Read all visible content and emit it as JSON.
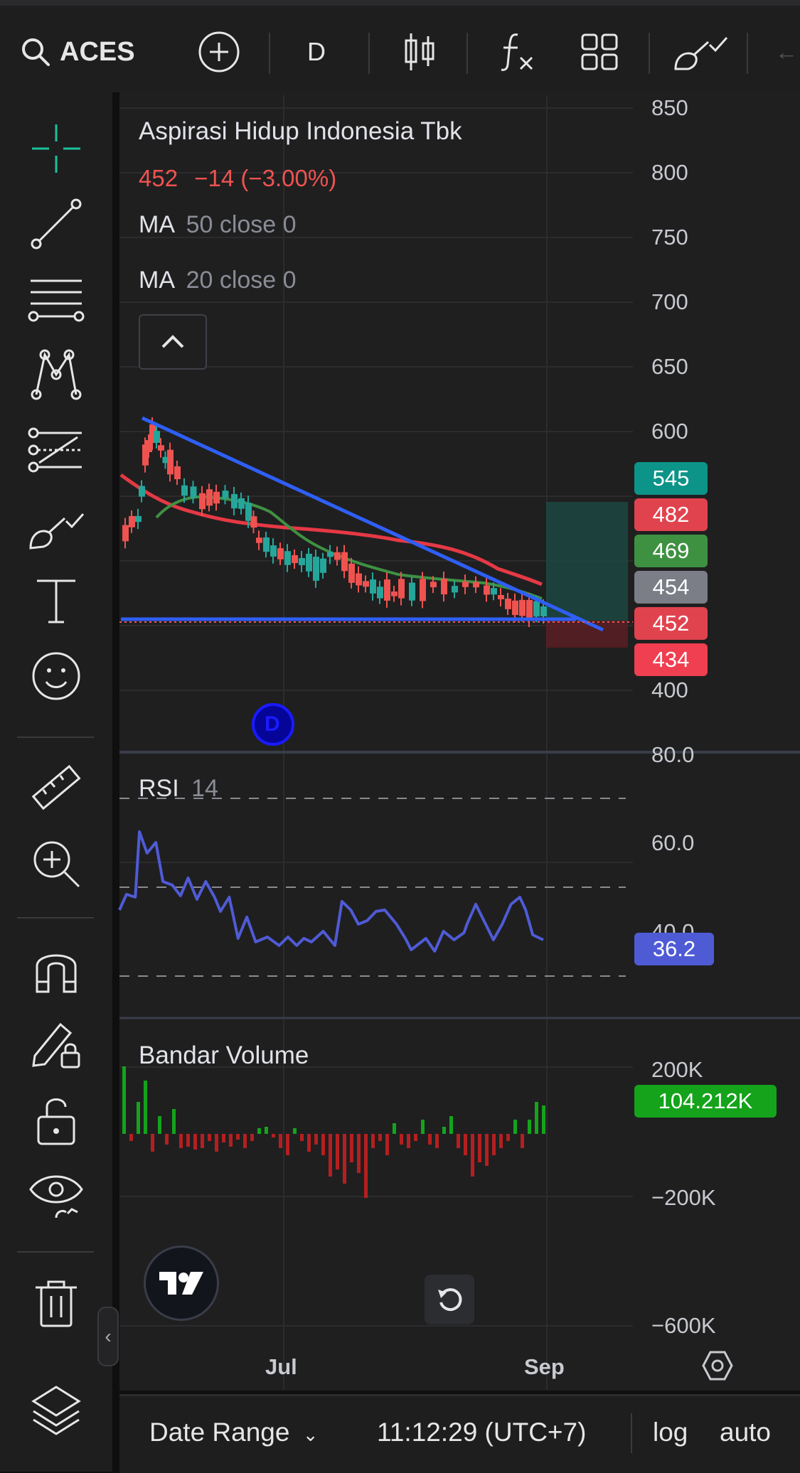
{
  "toolbar": {
    "symbol": "ACES",
    "interval": "D"
  },
  "legend": {
    "name": "Aspirasi Hidup Indonesia Tbk",
    "price": "452",
    "change": "−14 (−3.00%)",
    "ma50_label": "MA",
    "ma50_params": "50 close 0",
    "ma20_label": "MA",
    "ma20_params": "20 close 0"
  },
  "price_axis": [
    "850",
    "800",
    "750",
    "700",
    "650",
    "600",
    "400"
  ],
  "price_badges": [
    {
      "label": "545",
      "color": "#0d9488"
    },
    {
      "label": "482",
      "color": "#e0434e"
    },
    {
      "label": "469",
      "color": "#3f9142"
    },
    {
      "label": "454",
      "color": "#7b7e87"
    },
    {
      "label": "452",
      "color": "#e0434e"
    },
    {
      "label": "434",
      "color": "#ef3f50"
    }
  ],
  "rsi": {
    "label": "RSI",
    "param": "14",
    "axis": [
      "80.0",
      "60.0",
      "40.0"
    ],
    "value": "36.2",
    "value_color": "#4f5bd5"
  },
  "volume": {
    "label": "Bandar Volume",
    "axis": [
      "200K",
      "−200K",
      "−600K"
    ],
    "value": "104.212K",
    "value_color": "#14a31b"
  },
  "time_axis": {
    "jul": "Jul",
    "sep": "Sep"
  },
  "dividend_marker": "D",
  "bottom": {
    "date_range": "Date Range",
    "time": "11:12:29 (UTC+7)",
    "log": "log",
    "auto": "auto"
  },
  "colors": {
    "up": "#26a69a",
    "down": "#ef5350",
    "trendline": "#2f5ff5",
    "ma50": "#e53945",
    "ma20": "#3f9142",
    "rsi_line": "#4f5bd5"
  }
}
